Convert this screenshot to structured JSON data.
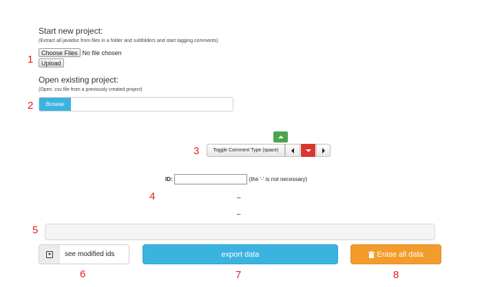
{
  "start_project": {
    "heading": "Start new project:",
    "description": "(Extract all javadoc from files in a folder and subfolders and start tagging comments)",
    "choose_files_label": "Choose Files",
    "file_status": "No file chosen",
    "upload_label": "Upload"
  },
  "open_project": {
    "heading": "Open existing project:",
    "description": "(Open .csv file from a previously created project)",
    "browse_label": "Browse",
    "path_value": ""
  },
  "toggle": {
    "label": "Toggle Comment Type (space)"
  },
  "id_field": {
    "label": "ID:",
    "value": "",
    "hint": "(the '-' is not necessary)"
  },
  "dash_lines": [
    "–",
    "–"
  ],
  "comment_box": {
    "value": ""
  },
  "actions": {
    "see_modified_label": "see modified ids",
    "export_label": "export data",
    "erase_label": "Erase all data"
  },
  "markers": [
    "1",
    "2",
    "3",
    "4",
    "5",
    "6",
    "7",
    "8"
  ],
  "colors": {
    "marker": "#e31a1c",
    "browse": "#3ab4df",
    "up_button": "#48a54a",
    "down_button": "#d9362f",
    "export": "#3ab4df",
    "erase": "#f39c2b"
  }
}
